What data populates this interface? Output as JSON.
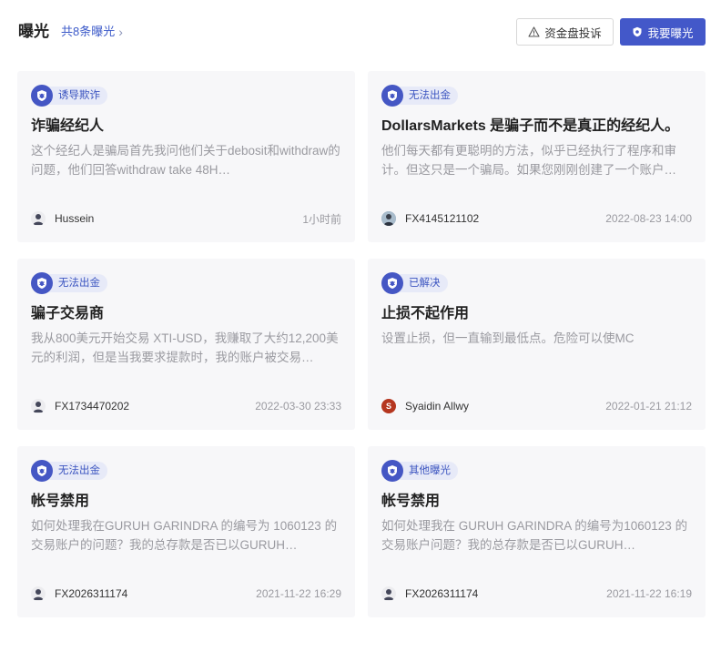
{
  "header": {
    "title": "曝光",
    "count_link": "共8条曝光",
    "complaint_button": "资金盘投诉",
    "expose_button": "我要曝光"
  },
  "cards": [
    {
      "tag": "诱导欺诈",
      "title": "诈骗经纪人",
      "desc": "这个经纪人是骗局首先我问他们关于debosit和withdraw的问题，他们回答withdraw take 48H…",
      "user": "Hussein",
      "avatar": "person-avatar",
      "time": "1小时前"
    },
    {
      "tag": "无法出金",
      "title": "DollarsMarkets 是骗子而不是真正的经纪人。",
      "desc": "他们每天都有更聪明的方法，似乎已经执行了程序和审计。但这只是一个骗局。如果您刚刚创建了一个账户…",
      "user": "FX4145121102",
      "avatar": "photo-avatar",
      "time": "2022-08-23 14:00"
    },
    {
      "tag": "无法出金",
      "title": "骗子交易商",
      "desc": "我从800美元开始交易 XTI-USD，我赚取了大约12,200美元的利润，但是当我要求提款时，我的账户被交易…",
      "user": "FX1734470202",
      "avatar": "person-avatar",
      "time": "2022-03-30 23:33"
    },
    {
      "tag": "已解决",
      "title": "止损不起作用",
      "desc": "设置止损，但一直输到最低点。危险可以使MC",
      "user": "Syaidin Allwy",
      "avatar": "letter-avatar",
      "avatar_letter": "S",
      "time": "2022-01-21 21:12"
    },
    {
      "tag": "无法出金",
      "title": "帐号禁用",
      "desc": "如何处理我在GURUH GARINDRA 的编号为 1060123 的交易账户的问题？我的总存款是否已以GURUH…",
      "user": "FX2026311174",
      "avatar": "person-avatar",
      "time": "2021-11-22 16:29"
    },
    {
      "tag": "其他曝光",
      "title": "帐号禁用",
      "desc": "如何处理我在 GURUH GARINDRA 的编号为1060123 的交易账户问题？我的总存款是否已以GURUH…",
      "user": "FX2026311174",
      "avatar": "person-avatar",
      "time": "2021-11-22 16:19"
    }
  ],
  "colors": {
    "accent": "#4358c9",
    "tag_bg": "#e7eaf8",
    "card_bg": "#f7f7f9"
  }
}
